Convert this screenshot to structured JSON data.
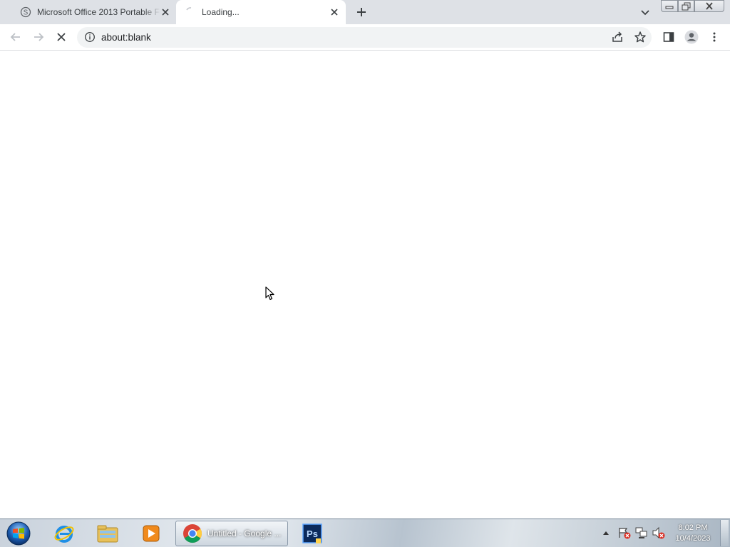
{
  "window": {
    "tabs": [
      {
        "title": "Microsoft Office 2013 Portable F",
        "favicon": "shield-s-icon",
        "active": false
      },
      {
        "title": "Loading...",
        "favicon": "loading-spinner-icon",
        "active": true
      }
    ],
    "controls": [
      "minimize-icon",
      "restore-icon",
      "close-icon"
    ]
  },
  "toolbar": {
    "url": "about:blank",
    "icons": [
      "back-arrow-icon",
      "forward-arrow-icon",
      "stop-loading-icon",
      "info-icon",
      "share-icon",
      "bookmark-star-icon",
      "side-panel-icon",
      "profile-icon",
      "menu-kebab-icon"
    ]
  },
  "taskbar": {
    "apps": [
      {
        "name": "internet-explorer-icon"
      },
      {
        "name": "file-explorer-icon"
      },
      {
        "name": "media-player-icon"
      },
      {
        "name": "chrome-icon",
        "label": "Untitled - Google ..."
      },
      {
        "name": "photoshop-icon"
      }
    ],
    "clock": {
      "time": "8:02 PM",
      "date": "10/4/2023"
    }
  },
  "colors": {
    "tabstrip": "#dee1e6",
    "omnibox": "#f1f3f4",
    "accent": "#1a73e8"
  }
}
